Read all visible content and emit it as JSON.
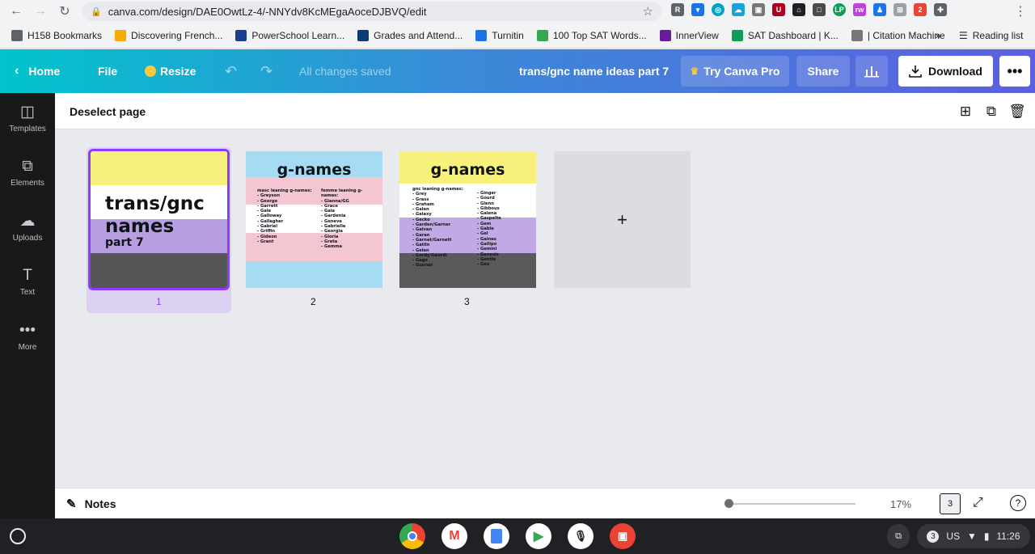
{
  "browser": {
    "url": "canva.com/design/DAE0OwtLz-4/-NNYdv8KcMEgaAoceDJBVQ/edit",
    "bookmarks": [
      {
        "label": "H158 Bookmarks",
        "color": "#5f6368"
      },
      {
        "label": "Discovering French...",
        "color": "#f9ab00"
      },
      {
        "label": "PowerSchool Learn...",
        "color": "#1a3f8f"
      },
      {
        "label": "Grades and Attend...",
        "color": "#0b3b75"
      },
      {
        "label": "Turnitin",
        "color": "#1a73e8"
      },
      {
        "label": "100 Top SAT Words...",
        "color": "#34a853"
      },
      {
        "label": "InnerView",
        "color": "#6a1b9a"
      },
      {
        "label": "SAT Dashboard | K...",
        "color": "#0f9d58"
      },
      {
        "label": "| Citation Machine",
        "color": "#777777"
      }
    ],
    "overflow": "»",
    "reading_list": "Reading list"
  },
  "header": {
    "home": "Home",
    "file": "File",
    "resize": "Resize",
    "status": "All changes saved",
    "doc_title": "trans/gnc name ideas part 7",
    "try_pro": "Try Canva Pro",
    "share": "Share",
    "download": "Download"
  },
  "sidebar": {
    "items": [
      {
        "label": "Templates",
        "icon": "templates-icon"
      },
      {
        "label": "Elements",
        "icon": "elements-icon"
      },
      {
        "label": "Uploads",
        "icon": "uploads-icon"
      },
      {
        "label": "Text",
        "icon": "text-icon"
      },
      {
        "label": "More",
        "icon": "more-icon"
      }
    ]
  },
  "toolbar": {
    "deselect": "Deselect page"
  },
  "pages": [
    {
      "number": "1",
      "title_lines": [
        "trans/gnc",
        "names",
        "part 7"
      ],
      "colors": [
        "#f7f07a",
        "#ffffff",
        "#b89ee0",
        "#555555"
      ]
    },
    {
      "number": "2",
      "title": "g-names",
      "colors": [
        "#a6dcf3",
        "#f3c6d2",
        "#ffffff",
        "#f3c6d2",
        "#a6dcf3"
      ],
      "col1_header": "masc leaning g-names:",
      "col1": [
        "- Greyson",
        "- George",
        "- Garrett",
        "- Gale",
        "- Galloway",
        "- Gallagher",
        "- Gabriel",
        "- Griffin",
        "- Gideon",
        "- Grant"
      ],
      "col2_header": "femme leaning g-names:",
      "col2": [
        "- Gianna/GG",
        "- Grace",
        "- Gaia",
        "- Gardenia",
        "- Geneve",
        "- Gabrielle",
        "- Georgia",
        "- Gloria",
        "- Greta",
        "- Gemma"
      ]
    },
    {
      "number": "3",
      "title": "g-names",
      "colors": [
        "#f7f07a",
        "#ffffff",
        "#c3a8e6",
        "#5a5a5a"
      ],
      "col1_header": "gnc leaning g-names:",
      "col1": [
        "- Grey",
        "- Grass",
        "- Graham",
        "- Galen",
        "- Galaxy",
        "- Gecko",
        "- Garden/Garner",
        "- Galvan",
        "- Garan",
        "- Garnet/Garnett",
        "- Gatlin",
        "- Gelen",
        "- Gordy/Geordi",
        "- Gage",
        "- Gunnar"
      ],
      "col2": [
        "- Ginger",
        "- Gourd",
        "- Glenn",
        "- Gibbous",
        "- Galena",
        "- Gaspeite",
        "- Gem",
        "- Gable",
        "- Gel",
        "- Gaines",
        "- Gallipo",
        "- Gemini",
        "- Genesis",
        "- Gentle",
        "- Geo"
      ]
    }
  ],
  "bottom": {
    "notes": "Notes",
    "zoom": "17%",
    "page_count": "3",
    "zoom_fraction": 0.04
  },
  "shelf": {
    "tray_badge": "3",
    "locale": "US",
    "time": "11:26"
  }
}
